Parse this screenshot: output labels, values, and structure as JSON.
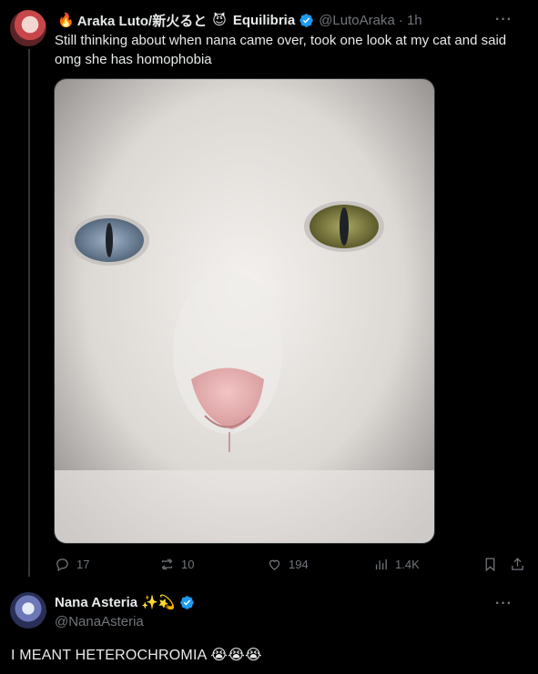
{
  "tweet": {
    "emoji_prefix": "🔥",
    "display_name": "Araka Luto/新火ると",
    "emoji_mid": "😈",
    "display_name_2": "Equilibria",
    "handle": "@LutoAraka",
    "time": "· 1h",
    "more": "···",
    "text": "Still thinking about when nana came over, took one look at my cat and said omg she has homophobia",
    "stats": {
      "replies": "17",
      "retweets": "10",
      "likes": "194",
      "views": "1.4K"
    }
  },
  "reply": {
    "display_name": "Nana Asteria",
    "emojis": "✨💫",
    "handle": "@NanaAsteria",
    "more": "···",
    "text": "I MEANT HETEROCHROMIA 😭😭😭"
  },
  "colors": {
    "background": "#000000",
    "text": "#e7e9ea",
    "muted": "#71767b",
    "verified": "#1d9bf0"
  }
}
